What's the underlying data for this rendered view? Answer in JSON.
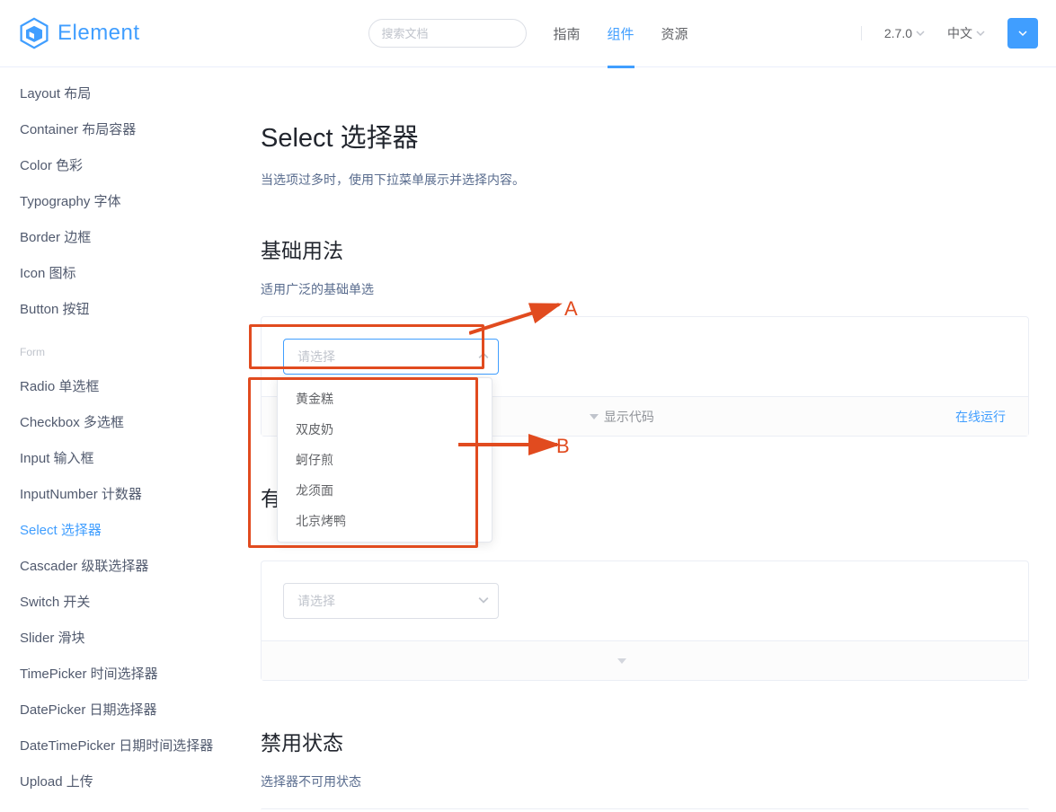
{
  "header": {
    "search_placeholder": "搜索文档",
    "nav": [
      "指南",
      "组件",
      "资源"
    ],
    "nav_active_index": 1,
    "version": "2.7.0",
    "lang": "中文"
  },
  "sidebar": {
    "items_top": [
      "Layout 布局",
      "Container 布局容器",
      "Color 色彩",
      "Typography 字体",
      "Border 边框",
      "Icon 图标",
      "Button 按钮"
    ],
    "group_form": "Form",
    "items_form": [
      "Radio 单选框",
      "Checkbox 多选框",
      "Input 输入框",
      "InputNumber 计数器",
      "Select 选择器",
      "Cascader 级联选择器",
      "Switch 开关",
      "Slider 滑块",
      "TimePicker 时间选择器",
      "DatePicker 日期选择器",
      "DateTimePicker 日期时间选择器",
      "Upload 上传"
    ],
    "active_form_index": 4
  },
  "main": {
    "page_title": "Select 选择器",
    "page_subtitle": "当选项过多时，使用下拉菜单展示并选择内容。",
    "section1_title": "基础用法",
    "section1_sub": "适用广泛的基础单选",
    "select_placeholder": "请选择",
    "demo_expand_label": "显示代码",
    "demo_run_label": "在线运行",
    "dropdown_options": [
      "黄金糕",
      "双皮奶",
      "蚵仔煎",
      "龙须面",
      "北京烤鸭"
    ],
    "section2_title_partial": "有",
    "section3_title": "禁用状态",
    "section3_sub": "选择器不可用状态"
  },
  "annotations": {
    "label_a": "A",
    "label_b": "B"
  }
}
